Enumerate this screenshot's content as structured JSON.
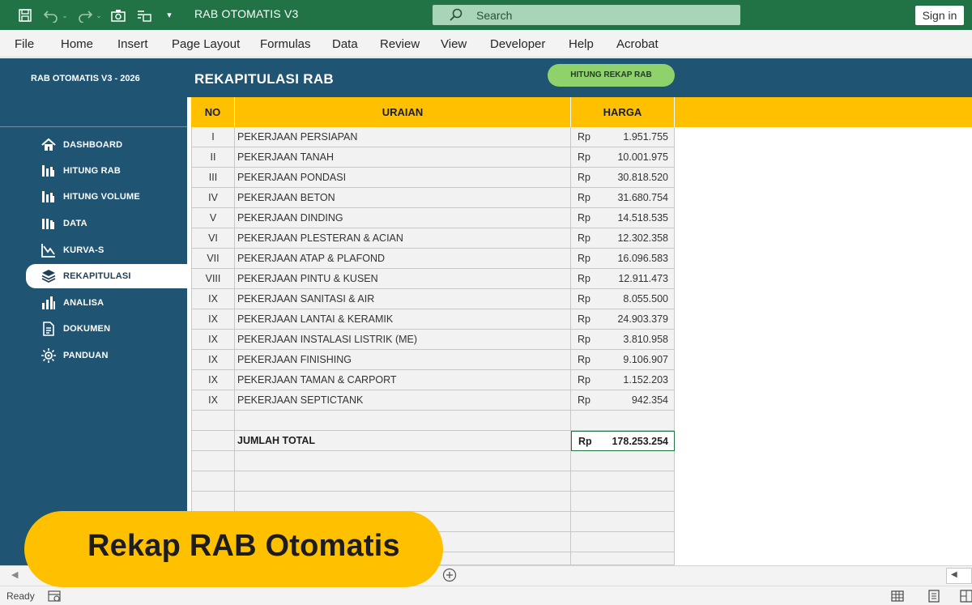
{
  "titlebar": {
    "title": "RAB OTOMATIS V3",
    "search_label": "Search",
    "signin_label": "Sign in",
    "bg_color": "#217346"
  },
  "menu": {
    "items": [
      "File",
      "Home",
      "Insert",
      "Page Layout",
      "Formulas",
      "Data",
      "Review",
      "View",
      "Developer",
      "Help",
      "Acrobat"
    ]
  },
  "sidebar": {
    "brand": "RAB OTOMATIS V3 - 2026",
    "items": [
      {
        "label": "DASHBOARD",
        "icon": "home-icon"
      },
      {
        "label": "HITUNG RAB",
        "icon": "chart-book-icon"
      },
      {
        "label": "HITUNG VOLUME",
        "icon": "chart-book-icon"
      },
      {
        "label": "DATA",
        "icon": "chart-book-icon"
      },
      {
        "label": "KURVA-S",
        "icon": "curve-chart-icon"
      },
      {
        "label": "REKAPITULASI",
        "icon": "layers-icon",
        "active": true
      },
      {
        "label": "ANALISA",
        "icon": "bar-chart-icon"
      },
      {
        "label": "DOKUMEN",
        "icon": "document-icon"
      },
      {
        "label": "PANDUAN",
        "icon": "gear-icon"
      }
    ]
  },
  "main": {
    "title": "REKAPITULASI RAB",
    "button_label": "HITUNG REKAP RAB",
    "accent_color": "#ffc000",
    "columns": {
      "no": "NO",
      "uraian": "URAIAN",
      "harga": "HARGA"
    },
    "currency": "Rp",
    "rows": [
      {
        "no": "I",
        "uraian": "PEKERJAAN PERSIAPAN",
        "harga": "1.951.755"
      },
      {
        "no": "II",
        "uraian": "PEKERJAAN TANAH",
        "harga": "10.001.975"
      },
      {
        "no": "III",
        "uraian": "PEKERJAAN PONDASI",
        "harga": "30.818.520"
      },
      {
        "no": "IV",
        "uraian": "PEKERJAAN BETON",
        "harga": "31.680.754"
      },
      {
        "no": "V",
        "uraian": "PEKERJAAN DINDING",
        "harga": "14.518.535"
      },
      {
        "no": "VI",
        "uraian": "PEKERJAAN PLESTERAN & ACIAN",
        "harga": "12.302.358"
      },
      {
        "no": "VII",
        "uraian": "PEKERJAAN ATAP & PLAFOND",
        "harga": "16.096.583"
      },
      {
        "no": "VIII",
        "uraian": "PEKERJAAN PINTU & KUSEN",
        "harga": "12.911.473"
      },
      {
        "no": "IX",
        "uraian": "PEKERJAAN SANITASI & AIR",
        "harga": "8.055.500"
      },
      {
        "no": "IX",
        "uraian": "PEKERJAAN LANTAI & KERAMIK",
        "harga": "24.903.379"
      },
      {
        "no": "IX",
        "uraian": "PEKERJAAN INSTALASI LISTRIK (ME)",
        "harga": "3.810.958"
      },
      {
        "no": "IX",
        "uraian": "PEKERJAAN FINISHING",
        "harga": "9.106.907"
      },
      {
        "no": "IX",
        "uraian": "PEKERJAAN TAMAN & CARPORT",
        "harga": "1.152.203"
      },
      {
        "no": "IX",
        "uraian": "PEKERJAAN SEPTICTANK",
        "harga": "942.354"
      }
    ],
    "total": {
      "label": "JUMLAH TOTAL",
      "currency": "Rp",
      "value": "178.253.254"
    }
  },
  "status": {
    "ready": "Ready"
  },
  "banner": {
    "text": "Rekap RAB Otomatis"
  }
}
